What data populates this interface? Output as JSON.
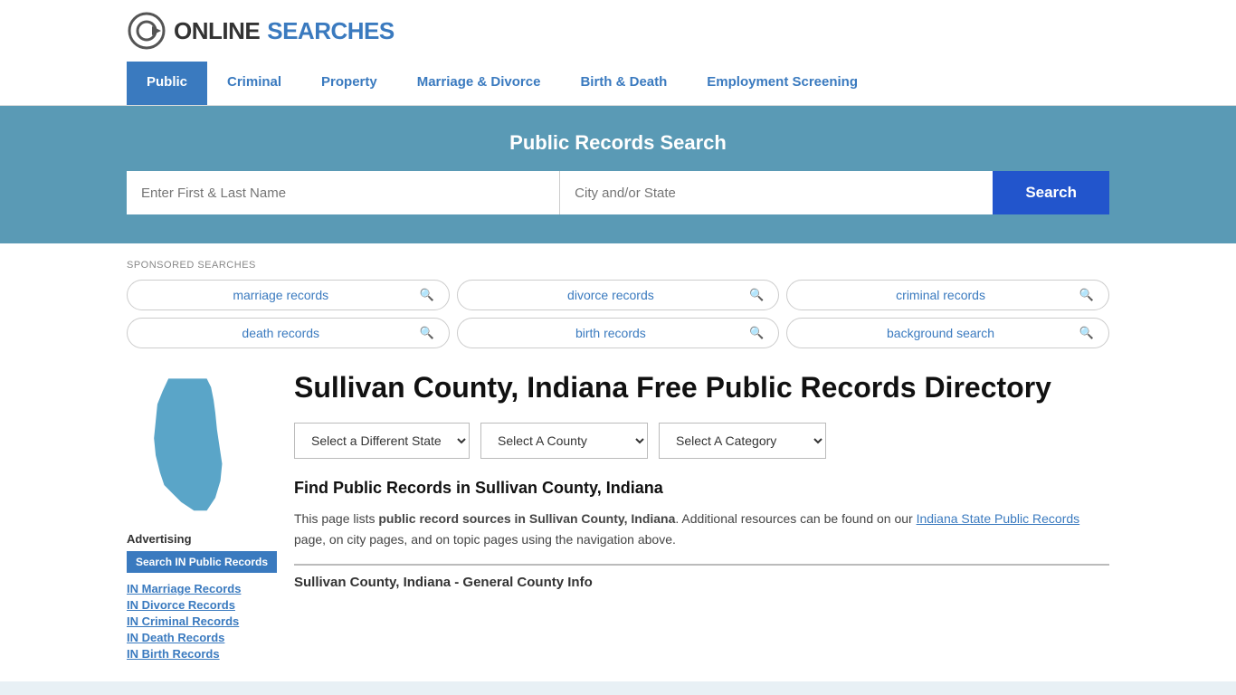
{
  "logo": {
    "text_online": "ONLINE",
    "text_searches": "SEARCHES"
  },
  "nav": {
    "items": [
      {
        "label": "Public",
        "active": true
      },
      {
        "label": "Criminal",
        "active": false
      },
      {
        "label": "Property",
        "active": false
      },
      {
        "label": "Marriage & Divorce",
        "active": false
      },
      {
        "label": "Birth & Death",
        "active": false
      },
      {
        "label": "Employment Screening",
        "active": false
      }
    ]
  },
  "search_banner": {
    "title": "Public Records Search",
    "name_placeholder": "Enter First & Last Name",
    "location_placeholder": "City and/or State",
    "search_label": "Search"
  },
  "sponsored": {
    "label": "SPONSORED SEARCHES",
    "items": [
      "marriage records",
      "divorce records",
      "criminal records",
      "death records",
      "birth records",
      "background search"
    ]
  },
  "page": {
    "title": "Sullivan County, Indiana Free Public Records Directory",
    "find_title": "Find Public Records in Sullivan County, Indiana",
    "description_plain": "This page lists ",
    "description_bold": "public record sources in Sullivan County, Indiana",
    "description_mid": ". Additional resources can be found on our ",
    "description_link": "Indiana State Public Records",
    "description_end": " page, on city pages, and on topic pages using the navigation above.",
    "county_info_label": "Sullivan County, Indiana - General County Info"
  },
  "dropdowns": {
    "state_label": "Select a Different State",
    "county_label": "Select A County",
    "category_label": "Select A Category"
  },
  "sidebar": {
    "advertising_label": "Advertising",
    "ad_btn_label": "Search IN Public Records",
    "links": [
      "IN Marriage Records",
      "IN Divorce Records",
      "IN Criminal Records",
      "IN Death Records",
      "IN Birth Records"
    ]
  }
}
